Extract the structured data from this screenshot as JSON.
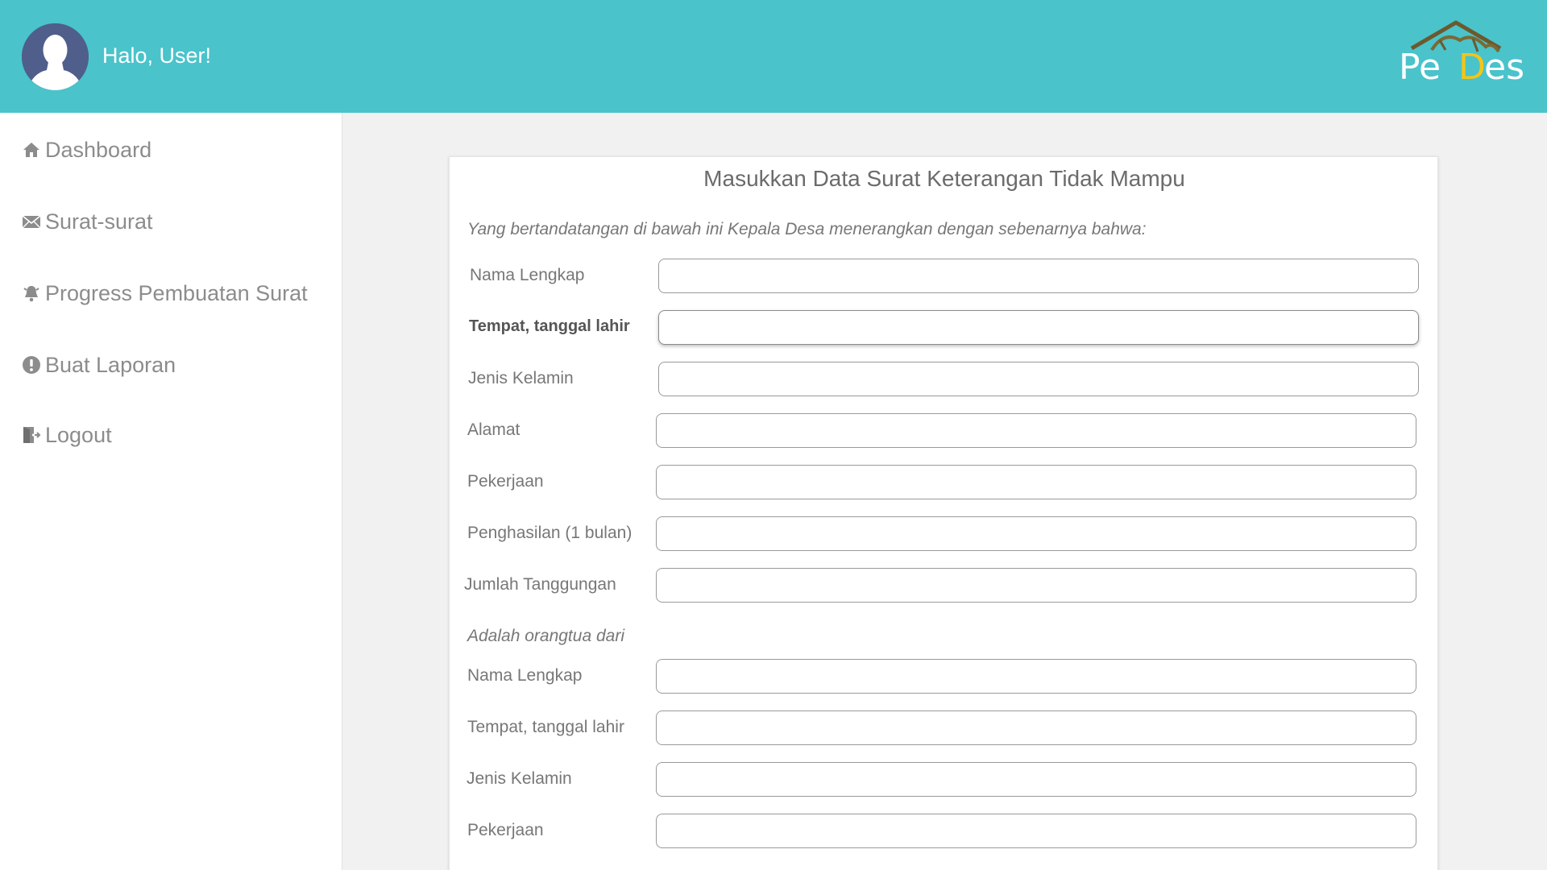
{
  "header": {
    "greeting": "Halo, User!",
    "logo_text": "PeDes",
    "avatar_icon": "user-avatar-icon",
    "bg_color": "#4ac3cb"
  },
  "sidebar": {
    "items": [
      {
        "label": "Dashboard",
        "icon": "home-icon"
      },
      {
        "label": "Surat-surat",
        "icon": "envelope-icon"
      },
      {
        "label": "Progress Pembuatan Surat",
        "icon": "bell-icon"
      },
      {
        "label": "Buat Laporan",
        "icon": "exclamation-icon"
      },
      {
        "label": "Logout",
        "icon": "logout-icon"
      }
    ]
  },
  "form": {
    "title": "Masukkan Data Surat Keterangan Tidak Mampu",
    "intro": "Yang bertandatangan di bawah ini Kepala Desa menerangkan dengan sebenarnya bahwa:",
    "fields": [
      {
        "label": "Nama Lengkap",
        "value": ""
      },
      {
        "label": "Tempat, tanggal lahir",
        "value": ""
      },
      {
        "label": "Jenis Kelamin",
        "value": ""
      },
      {
        "label": "Alamat",
        "value": ""
      },
      {
        "label": "Pekerjaan",
        "value": ""
      },
      {
        "label": "Penghasilan (1 bulan)",
        "value": ""
      },
      {
        "label": "Jumlah Tanggungan",
        "value": ""
      }
    ],
    "parent_section": "Adalah orangtua dari",
    "parent_fields": [
      {
        "label": "Nama Lengkap",
        "value": ""
      },
      {
        "label": "Tempat, tanggal lahir",
        "value": ""
      },
      {
        "label": "Jenis Kelamin",
        "value": ""
      },
      {
        "label": "Pekerjaan",
        "value": ""
      }
    ]
  }
}
